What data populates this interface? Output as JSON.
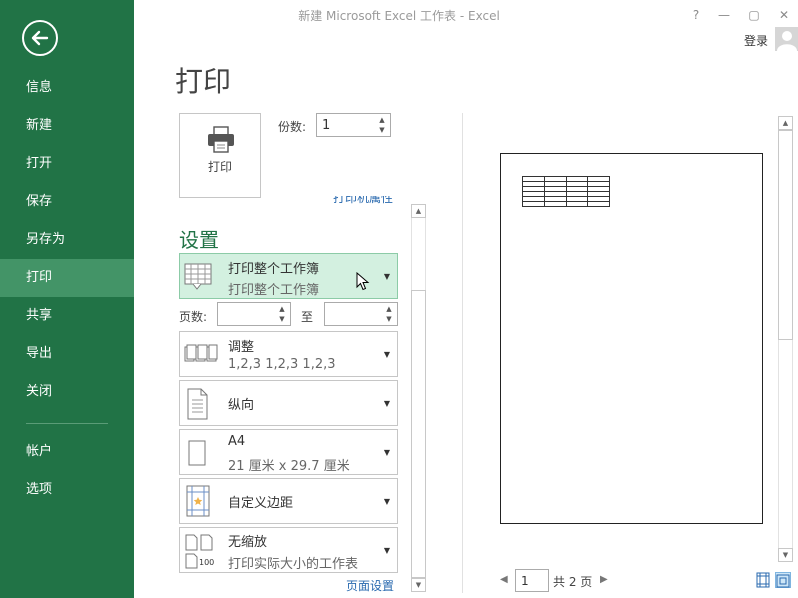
{
  "window": {
    "title": "新建 Microsoft Excel 工作表 - Excel",
    "help_icon": "?",
    "minimize_icon": "—",
    "restore_icon": "▢",
    "close_icon": "✕",
    "login_label": "登录"
  },
  "sidebar": {
    "back_icon": "back-arrow-icon",
    "items": [
      {
        "label": "信息"
      },
      {
        "label": "新建"
      },
      {
        "label": "打开"
      },
      {
        "label": "保存"
      },
      {
        "label": "另存为"
      },
      {
        "label": "打印",
        "active": true
      },
      {
        "label": "共享"
      },
      {
        "label": "导出"
      },
      {
        "label": "关闭"
      },
      {
        "label": "帐户"
      },
      {
        "label": "选项"
      }
    ]
  },
  "print": {
    "page_title": "打印",
    "print_button_label": "打印",
    "copies_label": "份数:",
    "copies_value": "1",
    "printer_properties_link": "打印机属性"
  },
  "settings": {
    "title": "设置",
    "what_to_print": {
      "title": "打印整个工作簿",
      "subtitle": "打印整个工作簿"
    },
    "pages_label": "页数:",
    "to_label": "至",
    "pages_from": "",
    "pages_to": "",
    "collate": {
      "title": "调整",
      "subtitle": "1,2,3    1,2,3    1,2,3"
    },
    "orientation": {
      "title": "纵向"
    },
    "paper": {
      "title": "A4",
      "subtitle": "21 厘米 x 29.7 厘米"
    },
    "margins": {
      "title": "自定义边距"
    },
    "scaling": {
      "title": "无缩放",
      "subtitle": "打印实际大小的工作表",
      "icon_text": "100"
    },
    "page_setup_link": "页面设置"
  },
  "preview": {
    "current_page": "1",
    "total_pages": "共 2 页"
  },
  "colors": {
    "accent": "#217346",
    "active_nav": "#439467",
    "selected_option": "#d3f0e0",
    "link": "#2a6aaf"
  }
}
